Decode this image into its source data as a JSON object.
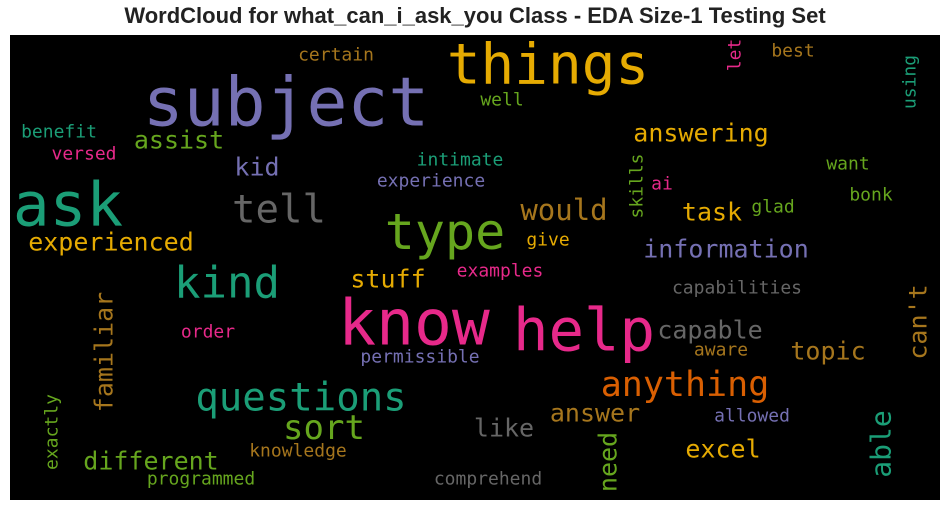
{
  "chart_data": {
    "type": "wordcloud",
    "title": "WordCloud for what_can_i_ask_you Class - EDA Size-1 Testing Set",
    "background": "#000000",
    "palette": [
      "#1b9e77",
      "#d95f02",
      "#7570b3",
      "#e7298a",
      "#66a61e",
      "#e6ab02",
      "#a6761d",
      "#666666"
    ],
    "words": [
      {
        "text": "subject",
        "color": "#7570b3"
      },
      {
        "text": "things",
        "color": "#e6ab02"
      },
      {
        "text": "ask",
        "color": "#1b9e77"
      },
      {
        "text": "tell",
        "color": "#666666"
      },
      {
        "text": "type",
        "color": "#66a61e"
      },
      {
        "text": "kind",
        "color": "#1b9e77"
      },
      {
        "text": "know",
        "color": "#e7298a"
      },
      {
        "text": "help",
        "color": "#e7298a"
      },
      {
        "text": "questions",
        "color": "#1b9e77"
      },
      {
        "text": "sort",
        "color": "#66a61e"
      },
      {
        "text": "anything",
        "color": "#d95f02"
      },
      {
        "text": "different",
        "color": "#66a61e"
      },
      {
        "text": "experienced",
        "color": "#e6ab02"
      },
      {
        "text": "assist",
        "color": "#66a61e"
      },
      {
        "text": "answering",
        "color": "#e6ab02"
      },
      {
        "text": "would",
        "color": "#a6761d"
      },
      {
        "text": "task",
        "color": "#e6ab02"
      },
      {
        "text": "information",
        "color": "#7570b3"
      },
      {
        "text": "stuff",
        "color": "#e6ab02"
      },
      {
        "text": "familiar",
        "color": "#a6761d"
      },
      {
        "text": "capable",
        "color": "#666666"
      },
      {
        "text": "topic",
        "color": "#a6761d"
      },
      {
        "text": "can't",
        "color": "#a6761d"
      },
      {
        "text": "answer",
        "color": "#a6761d"
      },
      {
        "text": "like",
        "color": "#666666"
      },
      {
        "text": "excel",
        "color": "#e6ab02"
      },
      {
        "text": "able",
        "color": "#1b9e77"
      },
      {
        "text": "need",
        "color": "#66a61e"
      },
      {
        "text": "kid",
        "color": "#7570b3"
      },
      {
        "text": "capabilities",
        "color": "#666666"
      },
      {
        "text": "aware",
        "color": "#a6761d"
      },
      {
        "text": "allowed",
        "color": "#7570b3"
      },
      {
        "text": "comprehend",
        "color": "#666666"
      },
      {
        "text": "knowledge",
        "color": "#a6761d"
      },
      {
        "text": "programmed",
        "color": "#66a61e"
      },
      {
        "text": "exactly",
        "color": "#66a61e"
      },
      {
        "text": "permissible",
        "color": "#7570b3"
      },
      {
        "text": "order",
        "color": "#e7298a"
      },
      {
        "text": "examples",
        "color": "#e7298a"
      },
      {
        "text": "certain",
        "color": "#a6761d"
      },
      {
        "text": "well",
        "color": "#66a61e"
      },
      {
        "text": "benefit",
        "color": "#1b9e77"
      },
      {
        "text": "versed",
        "color": "#e7298a"
      },
      {
        "text": "intimate",
        "color": "#1b9e77"
      },
      {
        "text": "experience",
        "color": "#7570b3"
      },
      {
        "text": "skills",
        "color": "#66a61e"
      },
      {
        "text": "ai",
        "color": "#e7298a"
      },
      {
        "text": "give",
        "color": "#e6ab02"
      },
      {
        "text": "glad",
        "color": "#66a61e"
      },
      {
        "text": "want",
        "color": "#66a61e"
      },
      {
        "text": "bonk",
        "color": "#66a61e"
      },
      {
        "text": "let",
        "color": "#e7298a"
      },
      {
        "text": "best",
        "color": "#a6761d"
      },
      {
        "text": "using",
        "color": "#1b9e77"
      }
    ]
  }
}
